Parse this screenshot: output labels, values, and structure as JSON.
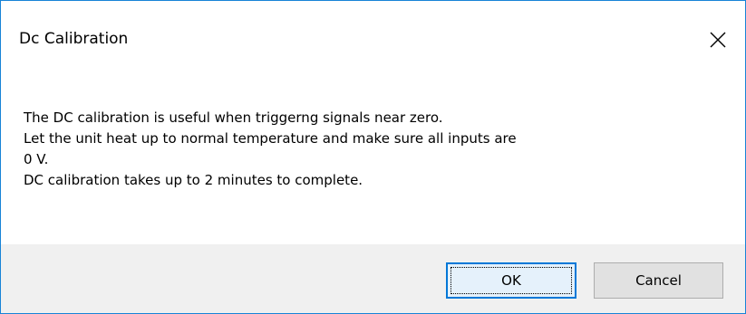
{
  "dialog": {
    "title": "Dc Calibration",
    "close_icon": "close-icon",
    "message_lines": [
      "The DC calibration is useful when triggerng signals near zero.",
      "Let the unit heat up to normal temperature and make sure all inputs are",
      "0 V.",
      "DC calibration takes up to 2 minutes to complete."
    ],
    "buttons": {
      "ok_label": "OK",
      "cancel_label": "Cancel"
    }
  },
  "colors": {
    "window_border": "#1883d7",
    "footer_background": "#f0f0f0",
    "default_button_border": "#0078d7"
  }
}
